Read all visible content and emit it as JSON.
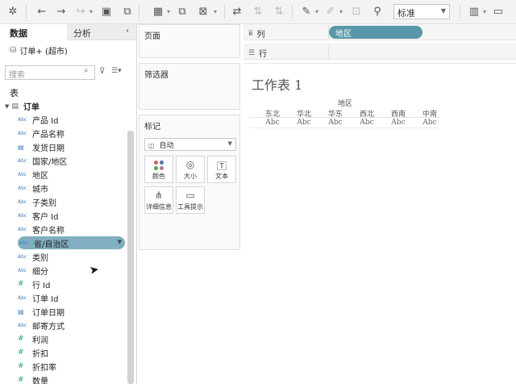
{
  "toolbar": {
    "fit_select": "标准"
  },
  "data_pane": {
    "tabs": {
      "data": "数据",
      "analysis": "分析"
    },
    "datasource": "订单+ (超市)",
    "search_placeholder": "搜索",
    "tables_heading": "表",
    "table_name": "订单",
    "fields": [
      {
        "type": "Abc",
        "name": "产品 Id"
      },
      {
        "type": "Abc",
        "name": "产品名称"
      },
      {
        "type": "date",
        "name": "发货日期"
      },
      {
        "type": "Abc",
        "name": "国家/地区"
      },
      {
        "type": "Abc",
        "name": "地区"
      },
      {
        "type": "Abc",
        "name": "城市"
      },
      {
        "type": "Abc",
        "name": "子类别"
      },
      {
        "type": "Abc",
        "name": "客户 Id"
      },
      {
        "type": "Abc",
        "name": "客户名称"
      },
      {
        "type": "Abc",
        "name": "省/自治区",
        "highlighted": true
      },
      {
        "type": "Abc",
        "name": "类别"
      },
      {
        "type": "Abc",
        "name": "细分"
      },
      {
        "type": "#",
        "name": "行 Id"
      },
      {
        "type": "Abc",
        "name": "订单 Id"
      },
      {
        "type": "date",
        "name": "订单日期"
      },
      {
        "type": "Abc",
        "name": "邮寄方式"
      },
      {
        "type": "#",
        "name": "利润"
      },
      {
        "type": "#",
        "name": "折扣"
      },
      {
        "type": "#",
        "name": "折扣率"
      },
      {
        "type": "#",
        "name": "数量"
      }
    ]
  },
  "cards": {
    "pages_title": "页面",
    "filters_title": "筛选器",
    "marks_title": "标记",
    "mark_type": "自动",
    "mark_buttons": {
      "color": "颜色",
      "size": "大小",
      "text": "文本",
      "detail": "详细信息",
      "tooltip": "工具提示"
    }
  },
  "shelves": {
    "columns_label": "列",
    "rows_label": "行",
    "columns_pill": "地区"
  },
  "view": {
    "title": "工作表 1",
    "column_header": "地区",
    "regions": [
      "东北",
      "华北",
      "华东",
      "西北",
      "西南",
      "中南"
    ],
    "cell_value": "Abc"
  },
  "colors": {
    "pill": "#5a97aa",
    "highlight": "#81aec0",
    "abc_type": "#3f7fbf",
    "measure_type": "#1f9e8c"
  }
}
